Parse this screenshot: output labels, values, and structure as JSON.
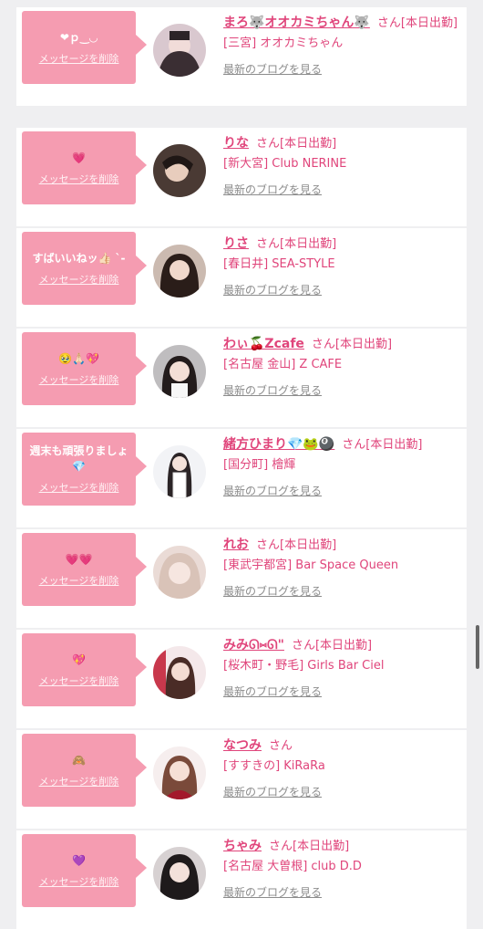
{
  "colors": {
    "accent": "#e0457b",
    "bubble": "#f59cb1"
  },
  "delete_label": "メッセージを削除",
  "blog_label": "最新のブログを見る",
  "entries": [
    {
      "message": "❤︎ｐ‿◡",
      "name": "まろ🐺オオカミちゃん🐺",
      "suffix": "さん[本日出勤]",
      "shop": "[三宮] オオカミちゃん"
    },
    {
      "message": "💗",
      "name": "りな",
      "suffix": "さん[本日出勤]",
      "shop": "[新大宮] Club NERINE"
    },
    {
      "message": "すばいいねッ👍🏻 `-",
      "name": "りさ",
      "suffix": "さん[本日出勤]",
      "shop": "[春日井] SEA-STYLE"
    },
    {
      "message": "🥹🙏🏻💖",
      "name": "わぃ🍒Zcafe",
      "suffix": "さん[本日出勤]",
      "shop": "[名古屋 金山] Z CAFE"
    },
    {
      "message": "週末も頑張りましょ💎",
      "name": "緒方ひまり💎🐸🎱",
      "suffix": "さん[本日出勤]",
      "shop": "[国分町] 檜輝"
    },
    {
      "message": "💗💗",
      "name": "れお",
      "suffix": "さん[本日出勤]",
      "shop": "[東武宇都宮] Bar Space Queen"
    },
    {
      "message": "💖",
      "name": "みみᘏ⑅ᘏ\"",
      "suffix": "さん[本日出勤]",
      "shop": "[桜木町・野毛] Girls Bar Ciel"
    },
    {
      "message": "🙈",
      "name": "なつみ",
      "suffix": "さん",
      "shop": "[すすきの] KiRaRa"
    },
    {
      "message": "💜",
      "name": "ちゃみ",
      "suffix": "さん[本日出勤]",
      "shop": "[名古屋 大曽根] club D.D"
    }
  ]
}
